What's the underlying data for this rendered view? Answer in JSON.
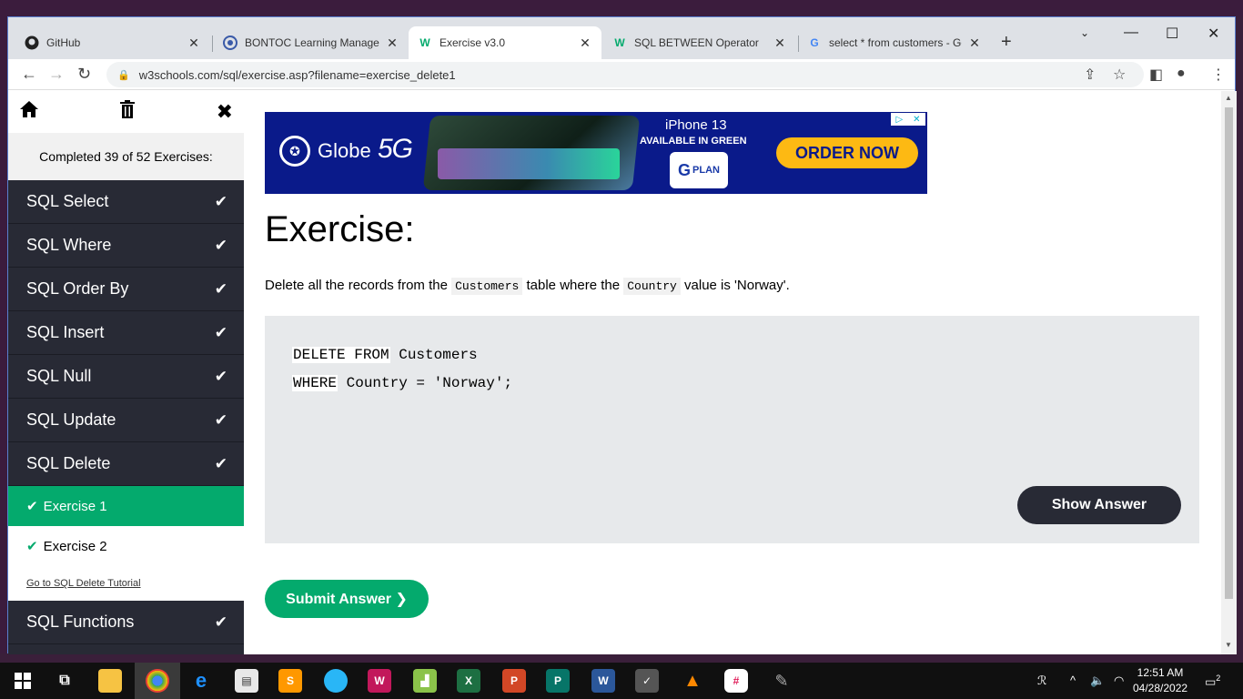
{
  "browser": {
    "tabs": [
      {
        "label": "GitHub",
        "icon": "github-icon"
      },
      {
        "label": "BONTOC Learning Managem",
        "icon": "moodle-icon"
      },
      {
        "label": "Exercise v3.0",
        "icon": "w3schools-icon"
      },
      {
        "label": "SQL BETWEEN Operator",
        "icon": "w3schools-icon"
      },
      {
        "label": "select * from customers - Go",
        "icon": "google-icon"
      }
    ],
    "url": "w3schools.com/sql/exercise.asp?filename=exercise_delete1"
  },
  "sidebar": {
    "status": "Completed 39 of 52 Exercises:",
    "items": [
      {
        "label": "SQL Select"
      },
      {
        "label": "SQL Where"
      },
      {
        "label": "SQL Order By"
      },
      {
        "label": "SQL Insert"
      },
      {
        "label": "SQL Null"
      },
      {
        "label": "SQL Update"
      },
      {
        "label": "SQL Delete"
      }
    ],
    "sub_items": [
      {
        "label": "Exercise 1"
      },
      {
        "label": "Exercise 2"
      }
    ],
    "tutorial_link": "Go to SQL Delete Tutorial",
    "after_items": [
      {
        "label": "SQL Functions"
      }
    ]
  },
  "ad": {
    "brand": "Globe",
    "network": "5G",
    "product": "iPhone 13",
    "tagline": "AVAILABLE IN GREEN",
    "plan": "PLAN",
    "cta": "ORDER NOW"
  },
  "main": {
    "heading": "Exercise:",
    "question_before": "Delete all the records from the",
    "table_name": "Customers",
    "question_middle": "table where the",
    "column_name": "Country",
    "question_after": "value is 'Norway'.",
    "code_line1_kw": "DELETE FROM",
    "code_line1_rest": " Customers",
    "code_line2_kw": "WHERE",
    "code_line2_rest": " Country = 'Norway';",
    "show_answer": "Show Answer",
    "submit": "Submit Answer ❯"
  },
  "taskbar": {
    "time": "12:51 AM",
    "date": "04/28/2022",
    "notifications": "2"
  },
  "colors": {
    "w3_green": "#04aa6d",
    "sidebar_dark": "#282a35",
    "code_bg": "#e7e9eb"
  }
}
